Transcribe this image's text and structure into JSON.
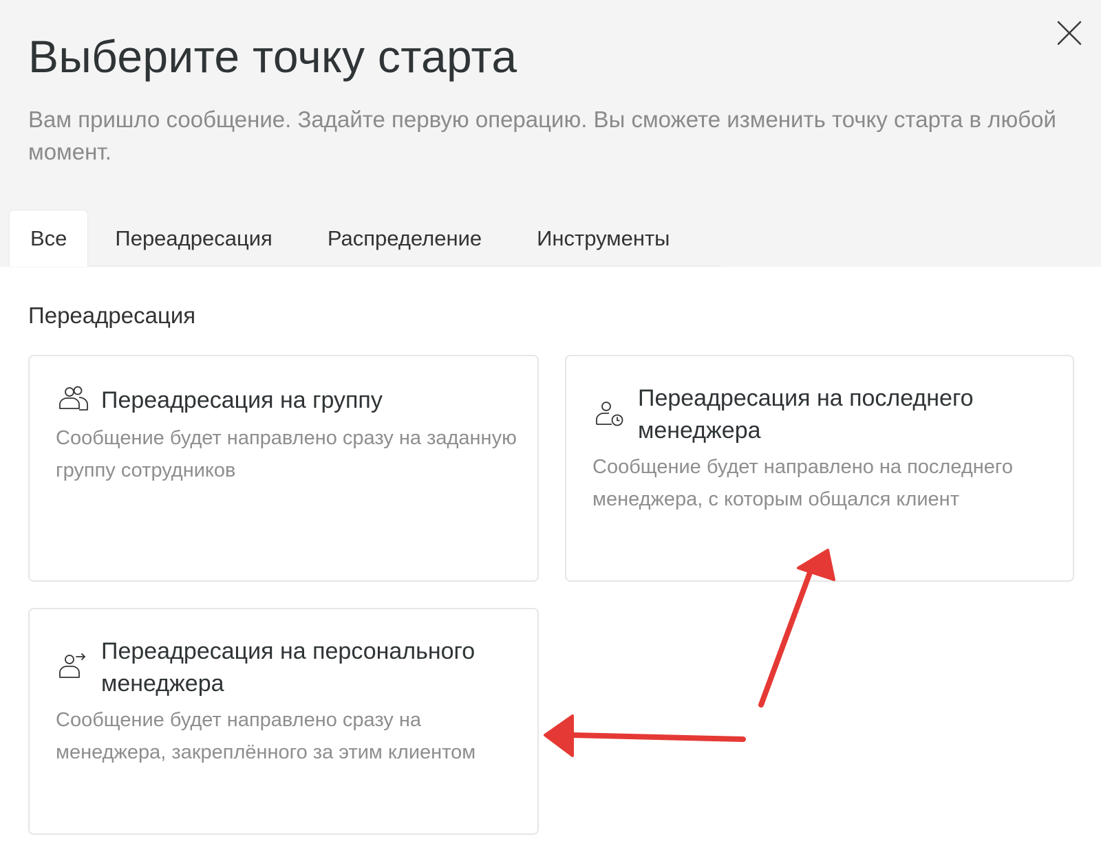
{
  "dialog": {
    "title": "Выберите точку старта",
    "subtitle": "Вам пришло сообщение. Задайте первую операцию. Вы сможете изменить точку старта в любой момент.",
    "close_icon": "close-icon"
  },
  "tabs": [
    {
      "label": "Все",
      "active": true
    },
    {
      "label": "Переадресация",
      "active": false
    },
    {
      "label": "Распределение",
      "active": false
    },
    {
      "label": "Инструменты",
      "active": false
    }
  ],
  "section": {
    "title": "Переадресация"
  },
  "cards": [
    {
      "icon": "group-users-icon",
      "title": "Переадресация на группу",
      "description": "Сообщение будет направлено сразу на заданную группу сотрудников"
    },
    {
      "icon": "user-clock-icon",
      "title": "Переадресация на последнего менеджера",
      "description": "Сообщение будет направлено на последнего менеджера, с которым общался клиент"
    },
    {
      "icon": "user-forward-icon",
      "title": "Переадресация на персонального менеджера",
      "description": "Сообщение будет направлено сразу на менеджера, закреплённого за этим клиентом"
    }
  ],
  "annotation": {
    "arrow_color": "#e53935"
  }
}
